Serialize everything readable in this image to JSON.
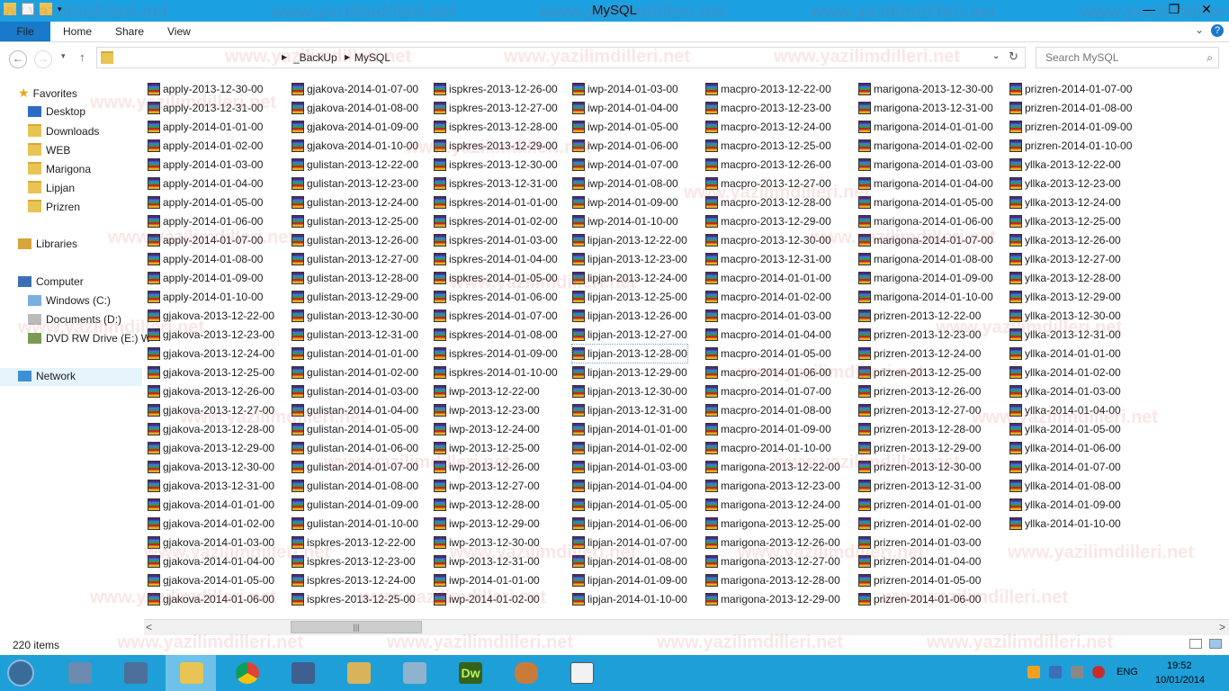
{
  "window": {
    "title": "MySQL"
  },
  "ribbon": {
    "tabs": [
      "File",
      "Home",
      "Share",
      "View"
    ]
  },
  "address": {
    "crumbs": [
      "_BackUp",
      "MySQL"
    ]
  },
  "search": {
    "placeholder": "Search MySQL"
  },
  "nav": {
    "favorites": "Favorites",
    "fav_items": [
      "Desktop",
      "Downloads",
      "WEB",
      "Marigona",
      "Lipjan",
      "Prizren"
    ],
    "libraries": "Libraries",
    "computer": "Computer",
    "drives": [
      "Windows (C:)",
      "Documents (D:)",
      "DVD RW Drive (E:) W"
    ],
    "network": "Network"
  },
  "files": {
    "selected": "lipjan-2013-12-28-00",
    "columns": [
      [
        "apply-2013-12-30-00",
        "apply-2013-12-31-00",
        "apply-2014-01-01-00",
        "apply-2014-01-02-00",
        "apply-2014-01-03-00",
        "apply-2014-01-04-00",
        "apply-2014-01-05-00",
        "apply-2014-01-06-00",
        "apply-2014-01-07-00",
        "apply-2014-01-08-00",
        "apply-2014-01-09-00",
        "apply-2014-01-10-00",
        "gjakova-2013-12-22-00",
        "gjakova-2013-12-23-00",
        "gjakova-2013-12-24-00",
        "gjakova-2013-12-25-00",
        "gjakova-2013-12-26-00",
        "gjakova-2013-12-27-00",
        "gjakova-2013-12-28-00",
        "gjakova-2013-12-29-00",
        "gjakova-2013-12-30-00",
        "gjakova-2013-12-31-00",
        "gjakova-2014-01-01-00",
        "gjakova-2014-01-02-00",
        "gjakova-2014-01-03-00",
        "gjakova-2014-01-04-00",
        "gjakova-2014-01-05-00",
        "gjakova-2014-01-06-00"
      ],
      [
        "gjakova-2014-01-07-00",
        "gjakova-2014-01-08-00",
        "gjakova-2014-01-09-00",
        "gjakova-2014-01-10-00",
        "gulistan-2013-12-22-00",
        "gulistan-2013-12-23-00",
        "gulistan-2013-12-24-00",
        "gulistan-2013-12-25-00",
        "gulistan-2013-12-26-00",
        "gulistan-2013-12-27-00",
        "gulistan-2013-12-28-00",
        "gulistan-2013-12-29-00",
        "gulistan-2013-12-30-00",
        "gulistan-2013-12-31-00",
        "gulistan-2014-01-01-00",
        "gulistan-2014-01-02-00",
        "gulistan-2014-01-03-00",
        "gulistan-2014-01-04-00",
        "gulistan-2014-01-05-00",
        "gulistan-2014-01-06-00",
        "gulistan-2014-01-07-00",
        "gulistan-2014-01-08-00",
        "gulistan-2014-01-09-00",
        "gulistan-2014-01-10-00",
        "ispkres-2013-12-22-00",
        "ispkres-2013-12-23-00",
        "ispkres-2013-12-24-00",
        "ispkres-2013-12-25-00"
      ],
      [
        "ispkres-2013-12-26-00",
        "ispkres-2013-12-27-00",
        "ispkres-2013-12-28-00",
        "ispkres-2013-12-29-00",
        "ispkres-2013-12-30-00",
        "ispkres-2013-12-31-00",
        "ispkres-2014-01-01-00",
        "ispkres-2014-01-02-00",
        "ispkres-2014-01-03-00",
        "ispkres-2014-01-04-00",
        "ispkres-2014-01-05-00",
        "ispkres-2014-01-06-00",
        "ispkres-2014-01-07-00",
        "ispkres-2014-01-08-00",
        "ispkres-2014-01-09-00",
        "ispkres-2014-01-10-00",
        "iwp-2013-12-22-00",
        "iwp-2013-12-23-00",
        "iwp-2013-12-24-00",
        "iwp-2013-12-25-00",
        "iwp-2013-12-26-00",
        "iwp-2013-12-27-00",
        "iwp-2013-12-28-00",
        "iwp-2013-12-29-00",
        "iwp-2013-12-30-00",
        "iwp-2013-12-31-00",
        "iwp-2014-01-01-00",
        "iwp-2014-01-02-00"
      ],
      [
        "iwp-2014-01-03-00",
        "iwp-2014-01-04-00",
        "iwp-2014-01-05-00",
        "iwp-2014-01-06-00",
        "iwp-2014-01-07-00",
        "iwp-2014-01-08-00",
        "iwp-2014-01-09-00",
        "iwp-2014-01-10-00",
        "lipjan-2013-12-22-00",
        "lipjan-2013-12-23-00",
        "lipjan-2013-12-24-00",
        "lipjan-2013-12-25-00",
        "lipjan-2013-12-26-00",
        "lipjan-2013-12-27-00",
        "lipjan-2013-12-28-00",
        "lipjan-2013-12-29-00",
        "lipjan-2013-12-30-00",
        "lipjan-2013-12-31-00",
        "lipjan-2014-01-01-00",
        "lipjan-2014-01-02-00",
        "lipjan-2014-01-03-00",
        "lipjan-2014-01-04-00",
        "lipjan-2014-01-05-00",
        "lipjan-2014-01-06-00",
        "lipjan-2014-01-07-00",
        "lipjan-2014-01-08-00",
        "lipjan-2014-01-09-00",
        "lipjan-2014-01-10-00"
      ],
      [
        "macpro-2013-12-22-00",
        "macpro-2013-12-23-00",
        "macpro-2013-12-24-00",
        "macpro-2013-12-25-00",
        "macpro-2013-12-26-00",
        "macpro-2013-12-27-00",
        "macpro-2013-12-28-00",
        "macpro-2013-12-29-00",
        "macpro-2013-12-30-00",
        "macpro-2013-12-31-00",
        "macpro-2014-01-01-00",
        "macpro-2014-01-02-00",
        "macpro-2014-01-03-00",
        "macpro-2014-01-04-00",
        "macpro-2014-01-05-00",
        "macpro-2014-01-06-00",
        "macpro-2014-01-07-00",
        "macpro-2014-01-08-00",
        "macpro-2014-01-09-00",
        "macpro-2014-01-10-00",
        "marigona-2013-12-22-00",
        "marigona-2013-12-23-00",
        "marigona-2013-12-24-00",
        "marigona-2013-12-25-00",
        "marigona-2013-12-26-00",
        "marigona-2013-12-27-00",
        "marigona-2013-12-28-00",
        "marigona-2013-12-29-00"
      ],
      [
        "marigona-2013-12-30-00",
        "marigona-2013-12-31-00",
        "marigona-2014-01-01-00",
        "marigona-2014-01-02-00",
        "marigona-2014-01-03-00",
        "marigona-2014-01-04-00",
        "marigona-2014-01-05-00",
        "marigona-2014-01-06-00",
        "marigona-2014-01-07-00",
        "marigona-2014-01-08-00",
        "marigona-2014-01-09-00",
        "marigona-2014-01-10-00",
        "prizren-2013-12-22-00",
        "prizren-2013-12-23-00",
        "prizren-2013-12-24-00",
        "prizren-2013-12-25-00",
        "prizren-2013-12-26-00",
        "prizren-2013-12-27-00",
        "prizren-2013-12-28-00",
        "prizren-2013-12-29-00",
        "prizren-2013-12-30-00",
        "prizren-2013-12-31-00",
        "prizren-2014-01-01-00",
        "prizren-2014-01-02-00",
        "prizren-2014-01-03-00",
        "prizren-2014-01-04-00",
        "prizren-2014-01-05-00",
        "prizren-2014-01-06-00"
      ],
      [
        "prizren-2014-01-07-00",
        "prizren-2014-01-08-00",
        "prizren-2014-01-09-00",
        "prizren-2014-01-10-00",
        "yllka-2013-12-22-00",
        "yllka-2013-12-23-00",
        "yllka-2013-12-24-00",
        "yllka-2013-12-25-00",
        "yllka-2013-12-26-00",
        "yllka-2013-12-27-00",
        "yllka-2013-12-28-00",
        "yllka-2013-12-29-00",
        "yllka-2013-12-30-00",
        "yllka-2013-12-31-00",
        "yllka-2014-01-01-00",
        "yllka-2014-01-02-00",
        "yllka-2014-01-03-00",
        "yllka-2014-01-04-00",
        "yllka-2014-01-05-00",
        "yllka-2014-01-06-00",
        "yllka-2014-01-07-00",
        "yllka-2014-01-08-00",
        "yllka-2014-01-09-00",
        "yllka-2014-01-10-00"
      ]
    ]
  },
  "status": {
    "count": "220 items"
  },
  "tray": {
    "lang": "ENG",
    "time": "19:52",
    "date": "10/01/2014"
  },
  "watermark": "www.yazilimdilleri.net",
  "icons": {
    "nav_back": "arrow-left-icon",
    "nav_forward": "arrow-right-icon",
    "nav_up": "arrow-up-icon",
    "refresh": "refresh-icon",
    "search": "search-icon",
    "file": "winrar-archive-icon"
  },
  "colors": {
    "titlebar": "#1ba1e2",
    "file_tab": "#1979ca",
    "taskbar": "#1e9fd8",
    "nav_selected": "#e5f3fb"
  }
}
